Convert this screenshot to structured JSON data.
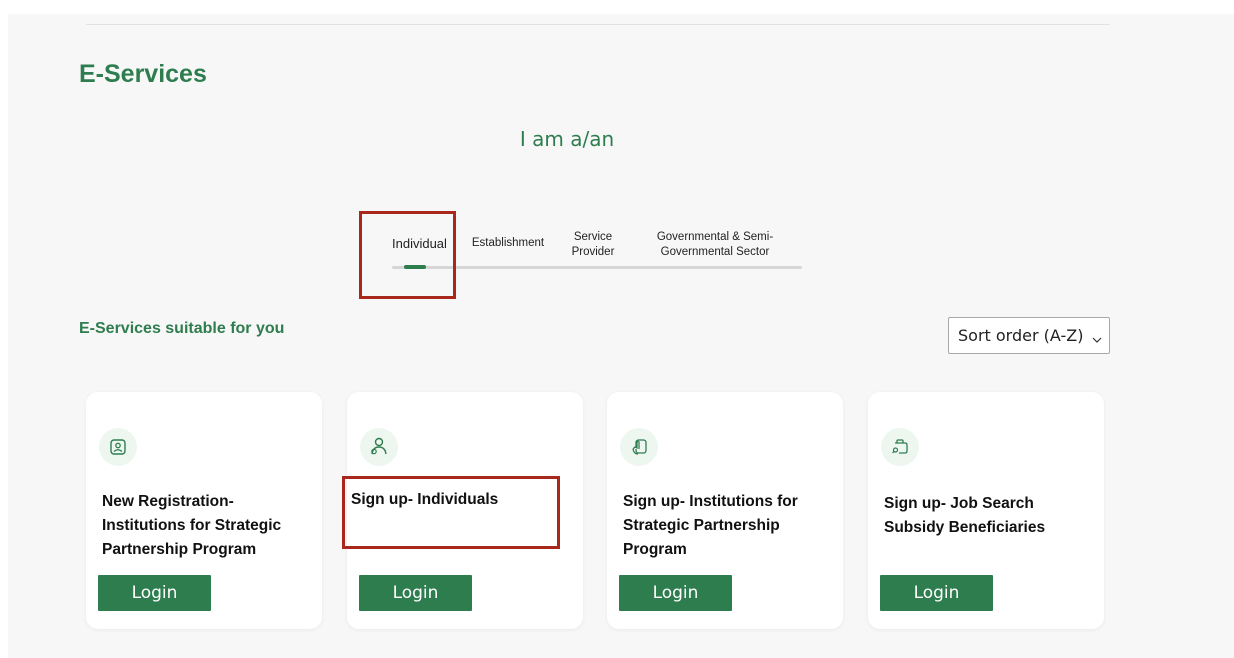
{
  "page": {
    "title": "E-Services",
    "subtitle": "I am a/an"
  },
  "tabs": [
    {
      "label": "Individual",
      "active": true
    },
    {
      "label": "Establishment",
      "active": false
    },
    {
      "label": "Service Provider",
      "active": false
    },
    {
      "label": "Governmental & Semi-Governmental Sector",
      "active": false
    }
  ],
  "section": {
    "title": "E-Services suitable for you"
  },
  "sort": {
    "selected": "Sort order (A-Z)"
  },
  "cards": [
    {
      "icon": "id-card-icon",
      "title": "New Registration- Institutions for Strategic Partnership Program",
      "button": "Login"
    },
    {
      "icon": "users-icon",
      "title": "Sign up- Individuals",
      "button": "Login"
    },
    {
      "icon": "hand-pointer-icon",
      "title": "Sign up- Institutions for Strategic Partnership Program",
      "button": "Login"
    },
    {
      "icon": "job-search-icon",
      "title": "Sign up- Job Search Subsidy Beneficiaries",
      "button": "Login"
    }
  ],
  "colors": {
    "brand": "#2e7d4f",
    "highlight": "#a8281d"
  }
}
